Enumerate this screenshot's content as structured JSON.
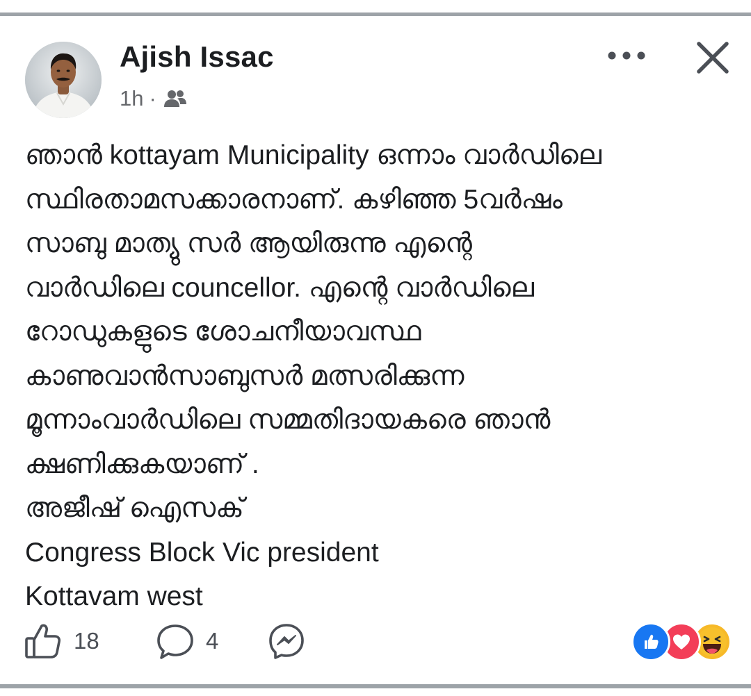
{
  "post": {
    "author": "Ajish Issac",
    "time": "1h",
    "separator": "·",
    "audience_icon": "friends-icon",
    "text_lines": [
      "ഞാൻ kottayam Municipality ഒന്നാം വാർഡിലെ",
      "സ്ഥിരതാമസക്കാരനാണ്. കഴിഞ്ഞ 5വർഷം",
      "സാബു മാത്യു സർ ആയിരുന്നു എന്റെ",
      "വാർഡിലെ councellor. എന്റെ വാർഡിലെ",
      "റോഡുകളുടെ ശോചനീയാവസ്ഥ",
      "കാണുവാൻസാബുസർ മത്സരിക്കുന്ന",
      "മൂന്നാംവാർഡിലെ സമ്മതിദായകരെ ഞാൻ",
      "ക്ഷണിക്കുകയാണ് .",
      "അജീഷ് ഐസക്",
      "Congress  Block Vic president",
      "Kottavam west"
    ]
  },
  "actions": {
    "like_count": "18",
    "comment_count": "4",
    "like_icon": "thumbs-up-icon",
    "comment_icon": "comment-bubble-icon",
    "share_icon": "messenger-icon"
  },
  "reactions": [
    "like-reaction-icon",
    "love-reaction-icon",
    "haha-reaction-icon"
  ],
  "colors": {
    "like_blue": "#1877f2",
    "love_red": "#f33e58",
    "haha_yellow": "#f7b928",
    "divider_gray": "#9da3a8",
    "secondary_text": "#65676b"
  }
}
